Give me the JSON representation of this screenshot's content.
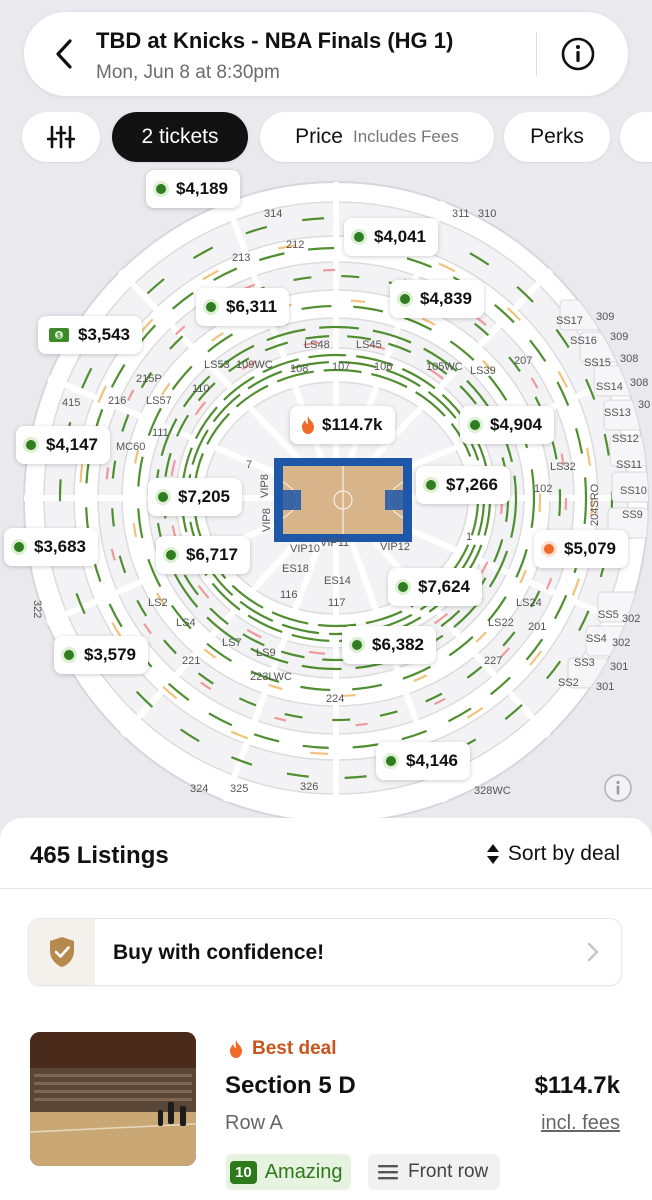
{
  "header": {
    "title": "TBD at Knicks - NBA Finals (HG 1)",
    "subtitle": "Mon, Jun 8 at 8:30pm"
  },
  "filters": {
    "settings_icon": "sliders-icon",
    "tickets_label": "2 tickets",
    "price_label": "Price",
    "price_sub": "Includes Fees",
    "perks_label": "Perks"
  },
  "map": {
    "section_labels": [
      "314",
      "311",
      "310",
      "213",
      "212",
      "215P",
      "216",
      "415",
      "111",
      "110",
      "109WC",
      "108",
      "107",
      "106",
      "105WC",
      "LS53",
      "LS57",
      "LS48",
      "LS45",
      "LS39",
      "207",
      "MC60",
      "7",
      "VIP8",
      "VIP8",
      "VIP10",
      "VIP11",
      "VIP12",
      "1",
      "LS32",
      "102",
      "ES18",
      "ES14",
      "116",
      "117",
      "LS2",
      "LS4",
      "LS7",
      "LS9",
      "LS24",
      "LS22",
      "201",
      "221",
      "223LWC",
      "227",
      "224",
      "322",
      "324",
      "325",
      "326",
      "328WC",
      "SS17",
      "SS16",
      "SS15",
      "SS14",
      "SS13",
      "SS12",
      "SS11",
      "SS10",
      "SS9",
      "SS5",
      "SS4",
      "SS3",
      "SS2",
      "309",
      "309",
      "308",
      "308",
      "30",
      "204SRO",
      "302",
      "302",
      "301",
      "301"
    ],
    "price_pins": [
      {
        "price": "$4,189",
        "type": "green"
      },
      {
        "price": "$4,041",
        "type": "green"
      },
      {
        "price": "$4,839",
        "type": "green"
      },
      {
        "price": "$6,311",
        "type": "green"
      },
      {
        "price": "$3,543",
        "type": "cash"
      },
      {
        "price": "$114.7k",
        "type": "fire"
      },
      {
        "price": "$4,904",
        "type": "green"
      },
      {
        "price": "$4,147",
        "type": "green"
      },
      {
        "price": "$7,205",
        "type": "green"
      },
      {
        "price": "$7,266",
        "type": "green"
      },
      {
        "price": "$3,683",
        "type": "green"
      },
      {
        "price": "$6,717",
        "type": "green"
      },
      {
        "price": "$5,079",
        "type": "orange"
      },
      {
        "price": "$7,624",
        "type": "green"
      },
      {
        "price": "$6,382",
        "type": "green"
      },
      {
        "price": "$3,579",
        "type": "green"
      },
      {
        "price": "$4,146",
        "type": "green"
      }
    ]
  },
  "listings": {
    "count_label": "465 Listings",
    "sort_label": "Sort by deal"
  },
  "confidence": {
    "label": "Buy with confidence!"
  },
  "listing": {
    "badge": "Best deal",
    "section": "Section 5 D",
    "row": "Row A",
    "price": "$114.7k",
    "fees_label": "incl. fees",
    "rating_score": "10",
    "rating_label": "Amazing",
    "perk_label": "Front row"
  },
  "colors": {
    "accent_green": "#2e7d1e",
    "deal_orange": "#c8551c",
    "court_blue": "#1f57a8",
    "dark_chip": "#121212"
  }
}
